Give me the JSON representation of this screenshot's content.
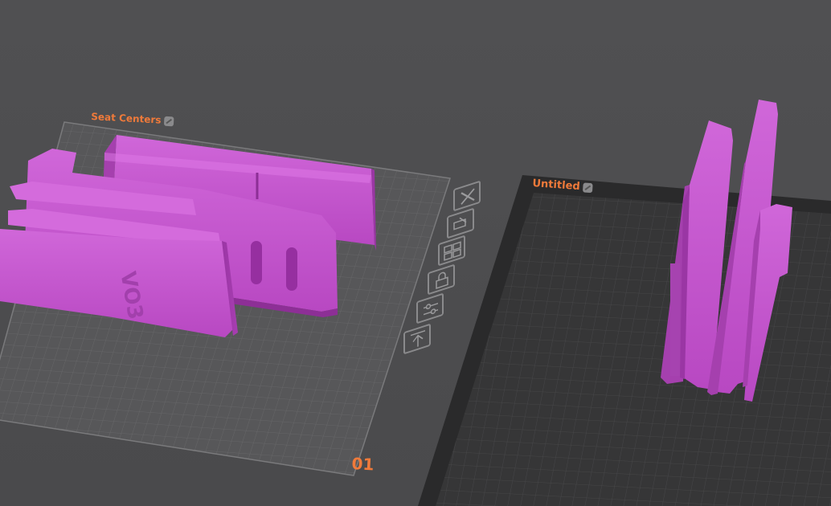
{
  "plates": [
    {
      "name": "Seat Centers",
      "number": "01"
    },
    {
      "name": "Untitled"
    }
  ],
  "toolbar": {
    "icons": [
      "delete-plate-icon",
      "auto-orient-icon",
      "arrange-icon",
      "lock-plate-icon",
      "plate-settings-icon",
      "move-plate-up-icon"
    ]
  },
  "colors": {
    "background": "#4c4c4e",
    "model": "#c74fd0",
    "accent": "#f07a3a",
    "plate_grid": "#5c5c5e",
    "plate_dark": "#2a2a2b"
  }
}
